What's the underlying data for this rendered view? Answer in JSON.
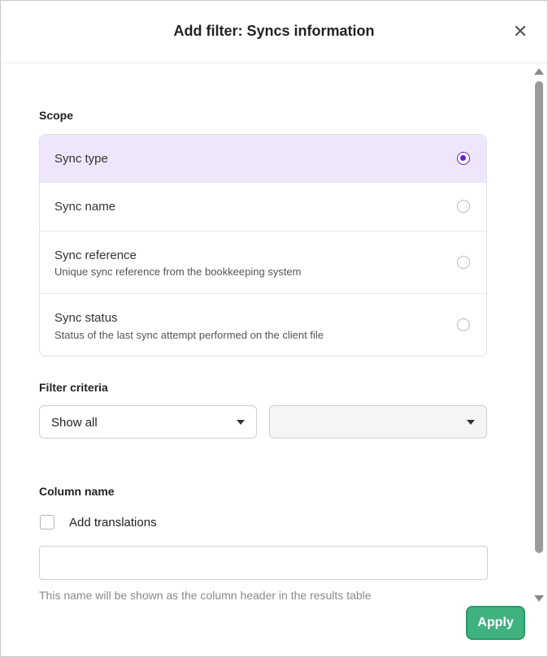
{
  "dialog": {
    "title": "Add filter: Syncs information",
    "close_label": "✕"
  },
  "scope": {
    "label": "Scope",
    "options": [
      {
        "label": "Sync type",
        "description": "",
        "selected": true
      },
      {
        "label": "Sync name",
        "description": "",
        "selected": false
      },
      {
        "label": "Sync reference",
        "description": "Unique sync reference from the bookkeeping system",
        "selected": false
      },
      {
        "label": "Sync status",
        "description": "Status of the last sync attempt performed on the client file",
        "selected": false
      }
    ]
  },
  "filter_criteria": {
    "label": "Filter criteria",
    "primary_value": "Show all",
    "secondary_value": ""
  },
  "column_name": {
    "label": "Column name",
    "add_translations_label": "Add translations",
    "add_translations_checked": false,
    "input_value": "",
    "helper_text": "This name will be shown as the column header in the results table"
  },
  "actions": {
    "apply_label": "Apply"
  },
  "colors": {
    "accent": "#6a1fd1",
    "selected_bg": "#efe6fb",
    "apply_bg": "#3fb27f"
  }
}
